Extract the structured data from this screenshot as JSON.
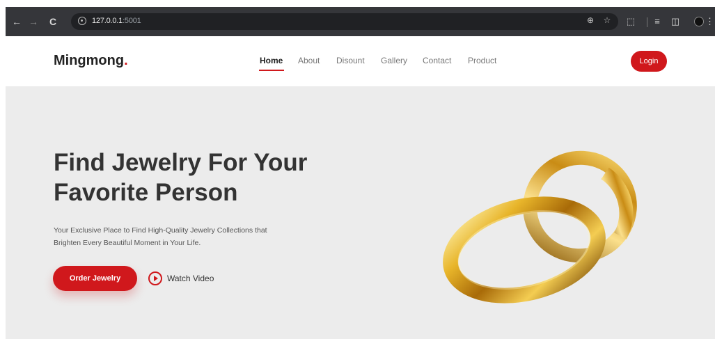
{
  "browser": {
    "url_host": "127.0.0.1",
    "url_port": ":5001",
    "back_icon": "←",
    "forward_icon": "→",
    "reload_icon": "C",
    "zoom_icon": "⊕",
    "star_icon": "☆",
    "extension_icon": "⬚",
    "tab_search_icon": "≡",
    "sidebar_icon": "◫",
    "menu_icon": "⋮"
  },
  "site": {
    "logo_text": "Mingmong",
    "logo_dot": ".",
    "nav": [
      {
        "label": "Home",
        "active": true
      },
      {
        "label": "About"
      },
      {
        "label": "Disount"
      },
      {
        "label": "Gallery"
      },
      {
        "label": "Contact"
      },
      {
        "label": "Product"
      }
    ],
    "login_label": "Login",
    "accent_color": "#d0181c"
  },
  "hero": {
    "title_line1": "Find Jewelry For Your",
    "title_line2": "Favorite Person",
    "subtitle_line1": "Your Exclusive Place to Find High-Quality Jewelry Collections that",
    "subtitle_line2": "Brighten Every Beautiful Moment in Your Life.",
    "order_label": "Order Jewelry",
    "watch_label": "Watch Video"
  }
}
